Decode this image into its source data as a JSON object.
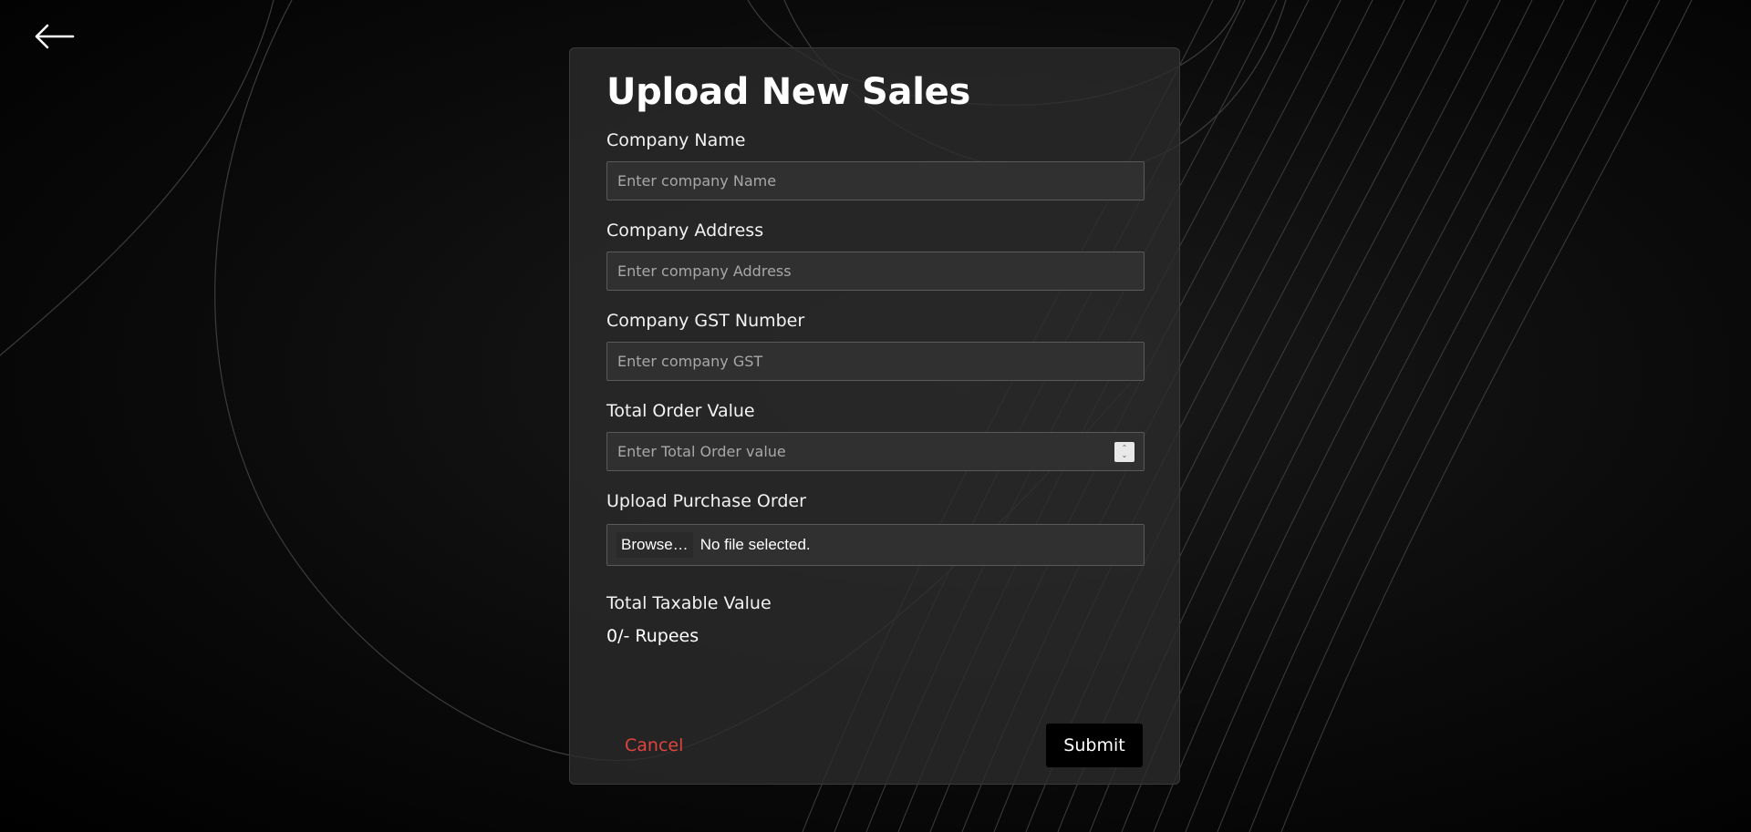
{
  "header": {
    "back_icon": "arrow-left-icon"
  },
  "form": {
    "title": "Upload New Sales",
    "fields": [
      {
        "label": "Company Name",
        "placeholder": "Enter company Name",
        "value": ""
      },
      {
        "label": "Company Address",
        "placeholder": "Enter company Address",
        "value": ""
      },
      {
        "label": "Company GST Number",
        "placeholder": "Enter company GST",
        "value": ""
      },
      {
        "label": "Total Order Value",
        "placeholder": "Enter Total Order value",
        "value": ""
      }
    ],
    "upload": {
      "label": "Upload Purchase Order",
      "browse_label": "Browse…",
      "status": "No file selected."
    },
    "taxable": {
      "label": "Total Taxable Value",
      "value": "0/- Rupees"
    },
    "actions": {
      "cancel_label": "Cancel",
      "submit_label": "Submit"
    }
  },
  "colors": {
    "background": "#000000",
    "card": "#2c2c2c",
    "cancel": "#e0443e",
    "submit_bg": "#000000"
  }
}
